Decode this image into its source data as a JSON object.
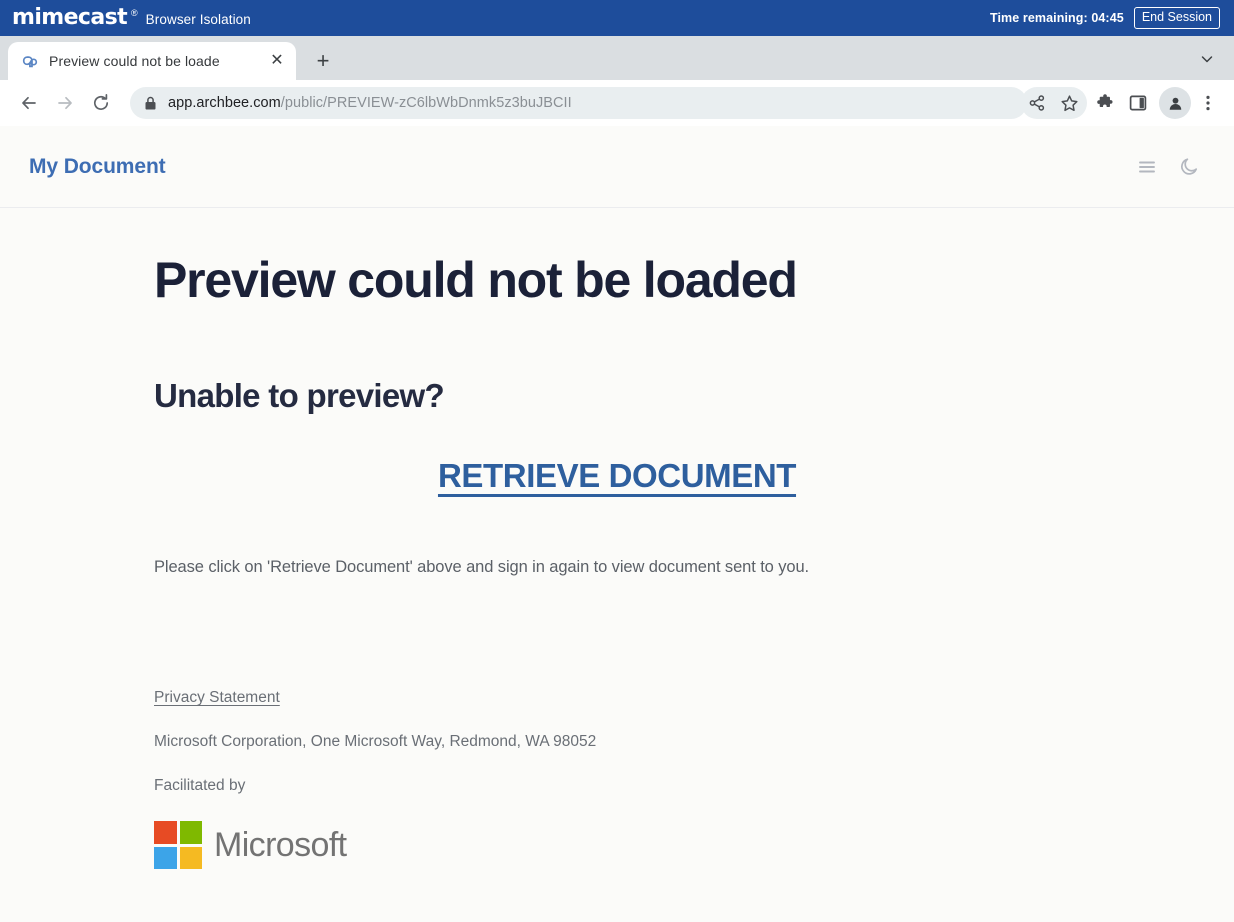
{
  "isolation_bar": {
    "brand": "mimecast",
    "brand_tm": "®",
    "product": "Browser Isolation",
    "time_remaining_label": "Time remaining: 04:45",
    "end_session_label": "End Session",
    "bg_color": "#1E4D9B"
  },
  "browser": {
    "tab": {
      "title": "Preview could not be loade",
      "favicon_name": "archbee-favicon",
      "close_glyph": "✕"
    },
    "new_tab_glyph": "+",
    "nav": {
      "back_glyph": "←",
      "forward_glyph": "→",
      "reload_glyph": "⟳"
    },
    "omnibox": {
      "lock_icon": "lock-icon",
      "url_host": "app.archbee.com",
      "url_path": "/public/PREVIEW-zC6lbWbDnmk5z3buJBCII",
      "full_url": "app.archbee.com/public/PREVIEW-zC6lbWbDnmk5z3buJBCII"
    },
    "toolbar_icons": [
      {
        "name": "share-icon"
      },
      {
        "name": "bookmark-star-icon"
      },
      {
        "name": "extensions-puzzle-icon"
      },
      {
        "name": "side-panel-icon"
      },
      {
        "name": "profile-avatar-icon"
      },
      {
        "name": "three-dot-menu-icon"
      }
    ]
  },
  "doc_header": {
    "title": "My Document",
    "title_color": "#3D6DB3",
    "icons": [
      {
        "name": "hamburger-menu-icon"
      },
      {
        "name": "dark-mode-moon-icon"
      }
    ]
  },
  "content": {
    "heading": "Preview could not be loaded",
    "subheading": "Unable to preview?",
    "retrieve_link": "RETRIEVE DOCUMENT",
    "retrieve_link_color": "#2E5F9E",
    "instruction": "Please click on 'Retrieve Document' above and sign in again to view document sent to you.",
    "privacy_link": "Privacy Statement",
    "address": "Microsoft Corporation, One Microsoft Way, Redmond, WA 98052",
    "facilitated_by": "Facilitated by",
    "ms_logo": {
      "wordmark": "Microsoft",
      "square_top_left": "#E74B24",
      "square_top_right": "#7FB900",
      "square_bottom_left": "#3CA4E8",
      "square_bottom_right": "#F5BA22"
    }
  },
  "page_bg": "#FBFBF9"
}
